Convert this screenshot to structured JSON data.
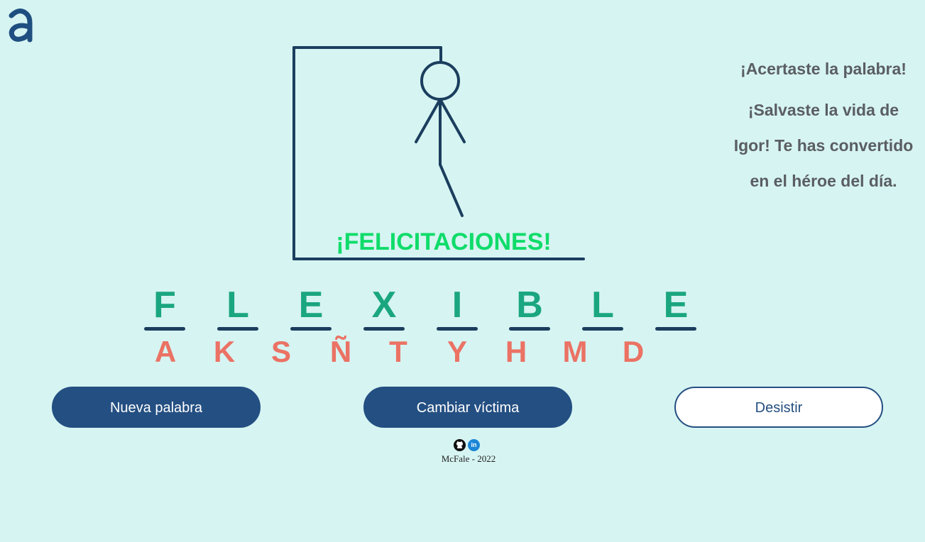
{
  "header": {
    "logo_icon": "a-logo-icon"
  },
  "game": {
    "status_banner": "¡FELICITACIONES!",
    "message_1": "¡Acertaste la palabra!",
    "message_2": "¡Salvaste la vida de Igor! Te has convertido en el héroe del día.",
    "word_letters": [
      "F",
      "L",
      "E",
      "X",
      "I",
      "B",
      "L",
      "E"
    ],
    "wrong_letters": [
      "A",
      "K",
      "S",
      "Ñ",
      "T",
      "Y",
      "H",
      "M",
      "D"
    ]
  },
  "buttons": {
    "new_word": "Nueva palabra",
    "change_victim": "Cambiar víctima",
    "give_up": "Desistir"
  },
  "footer": {
    "credit": "McFale - 2022",
    "github_icon": "github-icon",
    "linkedin_icon": "linkedin-icon"
  },
  "colors": {
    "background": "#d6f4f2",
    "correct_letter": "#1aa680",
    "wrong_letter": "#eb7264",
    "congrats": "#0fdc6a",
    "primary": "#244f82",
    "drawing": "#1b3e5e"
  }
}
